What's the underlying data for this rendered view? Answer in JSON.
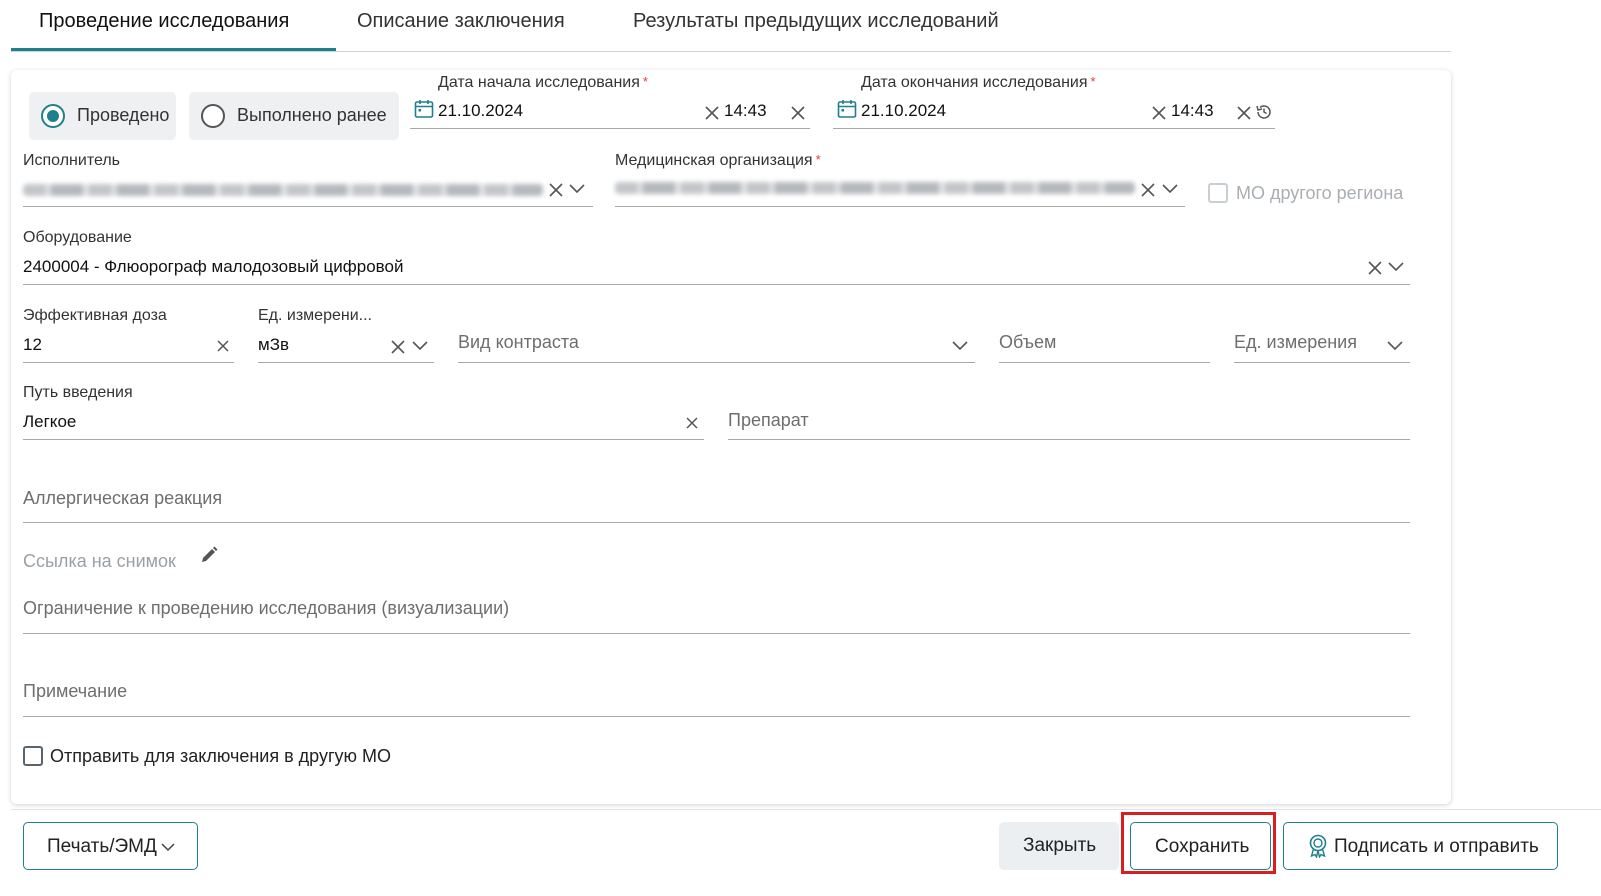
{
  "tabs": [
    {
      "label": "Проведение исследования",
      "active": true
    },
    {
      "label": "Описание заключения",
      "active": false
    },
    {
      "label": "Результаты предыдущих исследований",
      "active": false
    }
  ],
  "status_radio": {
    "options": [
      {
        "label": "Проведено",
        "selected": true
      },
      {
        "label": "Выполнено ранее",
        "selected": false
      }
    ]
  },
  "start": {
    "label": "Дата начала исследования",
    "required_mark": "*",
    "date": "21.10.2024",
    "time": "14:43"
  },
  "end": {
    "label": "Дата окончания исследования",
    "required_mark": "*",
    "date": "21.10.2024",
    "time": "14:43"
  },
  "performer": {
    "label": "Исполнитель"
  },
  "med_org": {
    "label": "Медицинская организация",
    "required_mark": "*"
  },
  "other_region": {
    "label": "МО другого региона",
    "checked": false,
    "disabled": true
  },
  "equipment": {
    "label": "Оборудование",
    "value": "2400004 - Флюорограф малодозовый цифровой"
  },
  "dose": {
    "label": "Эффективная доза",
    "value": "12"
  },
  "dose_unit": {
    "label": "Ед. измерени...",
    "value": "мЗв"
  },
  "contrast": {
    "placeholder": "Вид контраста"
  },
  "volume": {
    "placeholder": "Объем"
  },
  "volume_unit": {
    "placeholder": "Ед. измерения"
  },
  "route": {
    "label": "Путь введения",
    "value": "Легкое"
  },
  "drug": {
    "placeholder": "Препарат"
  },
  "allergy": {
    "placeholder": "Аллергическая реакция"
  },
  "image_link": {
    "placeholder": "Ссылка на снимок"
  },
  "restriction": {
    "placeholder": "Ограничение к проведению исследования (визуализации)"
  },
  "note": {
    "placeholder": "Примечание"
  },
  "send_other_mo": {
    "label": "Отправить для заключения в другую МО",
    "checked": false
  },
  "footer": {
    "print_label": "Печать/ЭМД",
    "close_label": "Закрыть",
    "save_label": "Сохранить",
    "sign_label": "Подписать и отправить"
  },
  "colors": {
    "accent": "#1f7f8c",
    "required": "#e53935",
    "highlight": "#d81e1e"
  }
}
